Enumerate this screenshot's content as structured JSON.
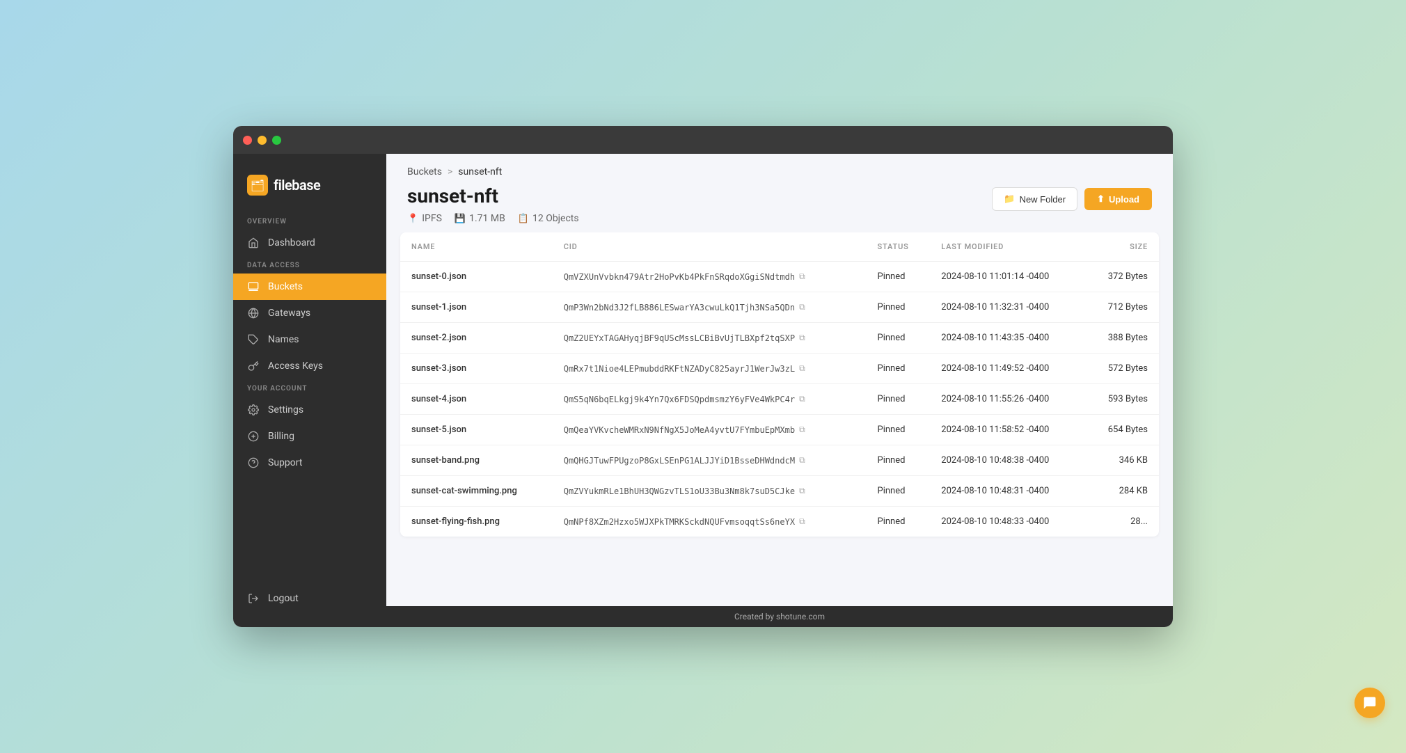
{
  "window": {
    "title": "filebase"
  },
  "sidebar": {
    "logo": "filebase",
    "logo_icon": "🗂",
    "sections": [
      {
        "label": "OVERVIEW",
        "items": [
          {
            "id": "dashboard",
            "label": "Dashboard",
            "icon": "home",
            "active": false
          }
        ]
      },
      {
        "label": "DATA ACCESS",
        "items": [
          {
            "id": "buckets",
            "label": "Buckets",
            "icon": "bucket",
            "active": true
          },
          {
            "id": "gateways",
            "label": "Gateways",
            "icon": "globe",
            "active": false
          },
          {
            "id": "names",
            "label": "Names",
            "icon": "tag",
            "active": false
          },
          {
            "id": "access-keys",
            "label": "Access Keys",
            "icon": "key",
            "active": false
          }
        ]
      },
      {
        "label": "YOUR ACCOUNT",
        "items": [
          {
            "id": "settings",
            "label": "Settings",
            "icon": "gear",
            "active": false
          },
          {
            "id": "billing",
            "label": "Billing",
            "icon": "dollar",
            "active": false
          },
          {
            "id": "support",
            "label": "Support",
            "icon": "help",
            "active": false
          }
        ]
      }
    ],
    "logout_label": "Logout"
  },
  "breadcrumb": {
    "parent": "Buckets",
    "separator": ">",
    "current": "sunset-nft"
  },
  "page": {
    "title": "sunset-nft",
    "protocol": "IPFS",
    "size": "1.71 MB",
    "objects": "12 Objects"
  },
  "actions": {
    "new_folder": "New Folder",
    "upload": "Upload"
  },
  "table": {
    "columns": [
      "NAME",
      "CID",
      "STATUS",
      "LAST MODIFIED",
      "SIZE"
    ],
    "rows": [
      {
        "name": "sunset-0.json",
        "cid": "QmVZXUnVvbkn479Atr2HoPvKb4PkFnSRqdoXGgiSNdtmdh",
        "status": "Pinned",
        "modified": "2024-08-10 11:01:14 -0400",
        "size": "372 Bytes"
      },
      {
        "name": "sunset-1.json",
        "cid": "QmP3Wn2bNd3J2fLB886LESwarYA3cwuLkQ1Tjh3NSa5QDn",
        "status": "Pinned",
        "modified": "2024-08-10 11:32:31 -0400",
        "size": "712 Bytes"
      },
      {
        "name": "sunset-2.json",
        "cid": "QmZ2UEYxTAGAHyqjBF9qUScMssLCBiBvUjTLBXpf2tqSXP",
        "status": "Pinned",
        "modified": "2024-08-10 11:43:35 -0400",
        "size": "388 Bytes"
      },
      {
        "name": "sunset-3.json",
        "cid": "QmRx7t1Nioe4LEPmubddRKFtNZADyC825ayrJ1WerJw3zL",
        "status": "Pinned",
        "modified": "2024-08-10 11:49:52 -0400",
        "size": "572 Bytes"
      },
      {
        "name": "sunset-4.json",
        "cid": "QmS5qN6bqELkgj9k4Yn7Qx6FDSQpdmsmzY6yFVe4WkPC4r",
        "status": "Pinned",
        "modified": "2024-08-10 11:55:26 -0400",
        "size": "593 Bytes"
      },
      {
        "name": "sunset-5.json",
        "cid": "QmQeaYVKvcheWMRxN9NfNgX5JoMeA4yvtU7FYmbuEpMXmb",
        "status": "Pinned",
        "modified": "2024-08-10 11:58:52 -0400",
        "size": "654 Bytes"
      },
      {
        "name": "sunset-band.png",
        "cid": "QmQHGJTuwFPUgzoP8GxLSEnPG1ALJJYiD1BsseDHWdndcM",
        "status": "Pinned",
        "modified": "2024-08-10 10:48:38 -0400",
        "size": "346 KB"
      },
      {
        "name": "sunset-cat-swimming.png",
        "cid": "QmZVYukmRLe1BhUH3QWGzvTLS1oU33Bu3Nm8k7suD5CJke",
        "status": "Pinned",
        "modified": "2024-08-10 10:48:31 -0400",
        "size": "284 KB"
      },
      {
        "name": "sunset-flying-fish.png",
        "cid": "QmNPf8XZm2Hzxo5WJXPkTMRKSckdNQUFvmsoqqtSs6neYX",
        "status": "Pinned",
        "modified": "2024-08-10 10:48:33 -0400",
        "size": "28..."
      }
    ]
  },
  "footer": {
    "text": "Created by shotune.com"
  },
  "colors": {
    "accent": "#f5a623",
    "sidebar_bg": "#2d2d2d",
    "active_item": "#f5a623"
  }
}
